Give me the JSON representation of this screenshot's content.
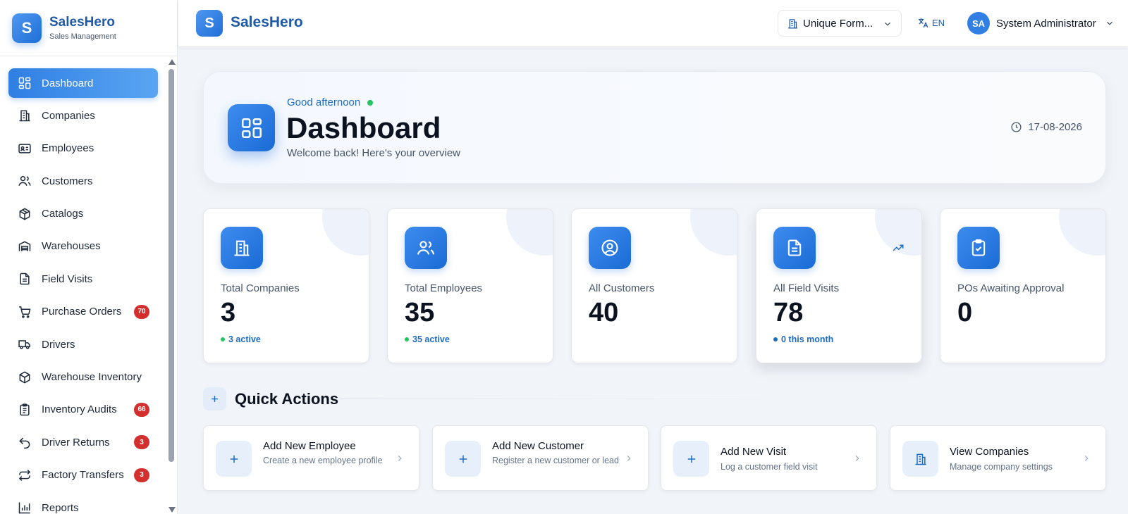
{
  "brand": {
    "logo_letter": "S",
    "name": "SalesHero",
    "subtitle": "Sales Management"
  },
  "sidebar": {
    "items": [
      {
        "label": "Dashboard",
        "icon": "grid-icon",
        "active": true
      },
      {
        "label": "Companies",
        "icon": "building-icon"
      },
      {
        "label": "Employees",
        "icon": "id-card-icon"
      },
      {
        "label": "Customers",
        "icon": "users-icon"
      },
      {
        "label": "Catalogs",
        "icon": "package-icon"
      },
      {
        "label": "Warehouses",
        "icon": "warehouse-icon"
      },
      {
        "label": "Field Visits",
        "icon": "document-icon"
      },
      {
        "label": "Purchase Orders",
        "icon": "cart-icon",
        "badge": "70"
      },
      {
        "label": "Drivers",
        "icon": "truck-icon"
      },
      {
        "label": "Warehouse Inventory",
        "icon": "box-icon"
      },
      {
        "label": "Inventory Audits",
        "icon": "clipboard-list-icon",
        "badge": "66"
      },
      {
        "label": "Driver Returns",
        "icon": "undo-icon",
        "badge": "3"
      },
      {
        "label": "Factory Transfers",
        "icon": "transfer-icon",
        "badge": "3"
      },
      {
        "label": "Reports",
        "icon": "bar-chart-icon"
      }
    ]
  },
  "topbar": {
    "logo_letter": "S",
    "brand": "SalesHero",
    "company_selector": "Unique Form...",
    "language": "EN",
    "user_initials": "SA",
    "user_name": "System Administrator"
  },
  "hero": {
    "greeting": "Good afternoon",
    "title": "Dashboard",
    "subtitle": "Welcome back! Here's your overview",
    "date": "17-08-2026"
  },
  "stats": {
    "companies": {
      "label": "Total Companies",
      "value": "3",
      "sub": "3 active",
      "icon": "building-icon"
    },
    "employees": {
      "label": "Total Employees",
      "value": "35",
      "sub": "35 active",
      "icon": "users-icon"
    },
    "customers": {
      "label": "All Customers",
      "value": "40",
      "icon": "user-circle-icon"
    },
    "visits": {
      "label": "All Field Visits",
      "value": "78",
      "sub": "0 this month",
      "icon": "document-icon"
    },
    "pos": {
      "label": "POs Awaiting Approval",
      "value": "0",
      "icon": "clipboard-check-icon"
    }
  },
  "quick_actions": {
    "title": "Quick Actions",
    "items": [
      {
        "title": "Add New Employee",
        "desc": "Create a new employee profile",
        "icon": "plus-icon"
      },
      {
        "title": "Add New Customer",
        "desc": "Register a new customer or lead",
        "icon": "plus-icon"
      },
      {
        "title": "Add New Visit",
        "desc": "Log a customer field visit",
        "icon": "plus-icon"
      },
      {
        "title": "View Companies",
        "desc": "Manage company settings",
        "icon": "building-icon"
      }
    ]
  },
  "colors": {
    "accent": "#2f7fe4",
    "brand_text": "#1e5aa8",
    "badge": "#d32f2f",
    "active_dot": "#22c55e",
    "info_dot": "#1e6bbf"
  }
}
